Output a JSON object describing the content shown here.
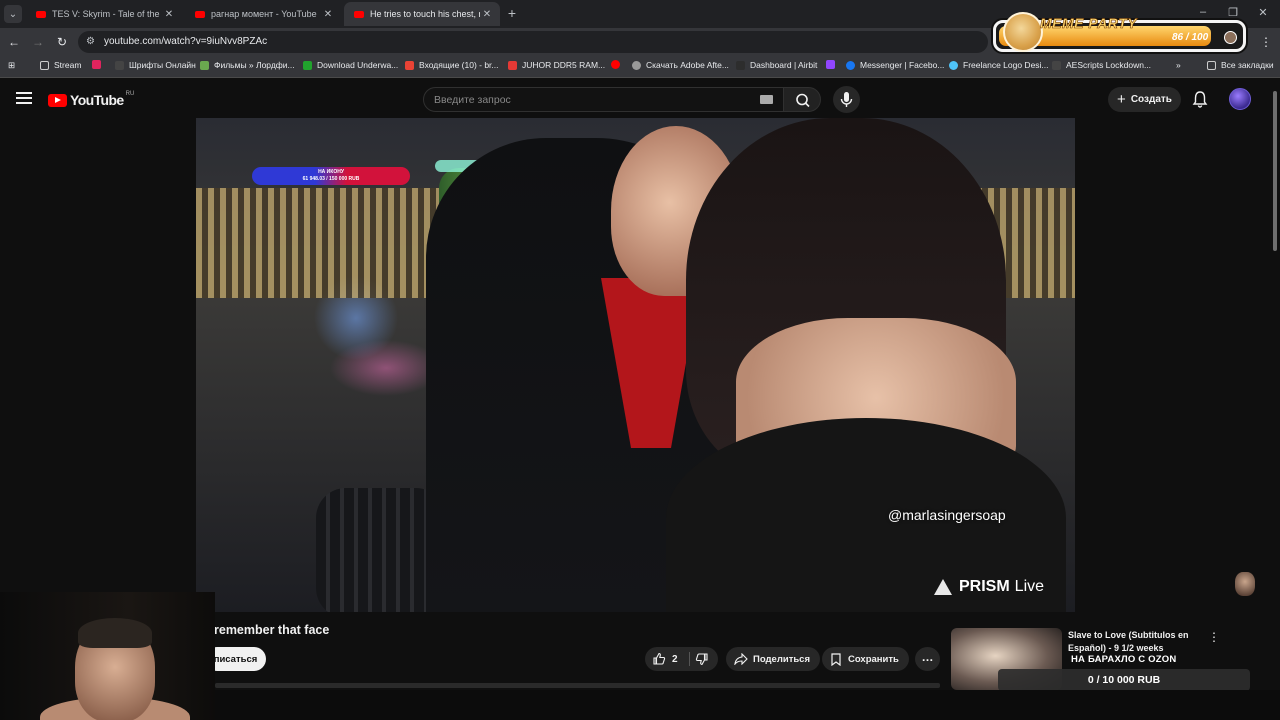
{
  "browser": {
    "tabs": [
      {
        "title": "TES V: Skyrim - Tale of the Tongues"
      },
      {
        "title": "рагнар момент - YouTube"
      },
      {
        "title": "He tries to touch his chest, remember that face"
      }
    ],
    "url": "youtube.com/watch?v=9iuNvv8PZAc",
    "bookmarks": [
      {
        "label": "Stream"
      },
      {
        "label": "Шрифты Онлайн"
      },
      {
        "label": "Фильмы » Лордфи..."
      },
      {
        "label": "Download Underwa..."
      },
      {
        "label": "Входящие (10) - br..."
      },
      {
        "label": "JUHOR DDR5 RAM..."
      },
      {
        "label": "Скачать Adobe Afte..."
      },
      {
        "label": "Dashboard | Airbit"
      },
      {
        "label": "Messenger | Facebo..."
      },
      {
        "label": "Freelance Logo Desi..."
      },
      {
        "label": "AEScripts Lockdown..."
      }
    ],
    "all_bookmarks": "Все закладки"
  },
  "overlay": {
    "meme_title": "MEME PARTY",
    "meme_count": "86 / 100",
    "meme_progress": 0.86,
    "donation_label": "НА ИКОНУ",
    "donation_amount": "61 948.03 / 150 000 RUB",
    "ozon_title": "НА БАРАХЛО С OZON",
    "ozon_amount": "0 / 10 000 RUB"
  },
  "youtube": {
    "logo": "YouTube",
    "region": "RU",
    "search_placeholder": "Введите запрос",
    "create_label": "Создать"
  },
  "video": {
    "watermark_handle": "@marlasingersoap",
    "watermark_brand": "PRISM",
    "watermark_live": "Live",
    "title": "remember that face",
    "subscribe_label": "писаться",
    "likes": "2",
    "share_label": "Поделиться",
    "save_label": "Сохранить"
  },
  "recommendation": {
    "title": "Slave to Love (Subtitulos en Español) - 9 1/2 weeks"
  },
  "colors": {
    "yt_red": "#ff0000",
    "background": "#0f0f0f",
    "pill": "#272727"
  }
}
